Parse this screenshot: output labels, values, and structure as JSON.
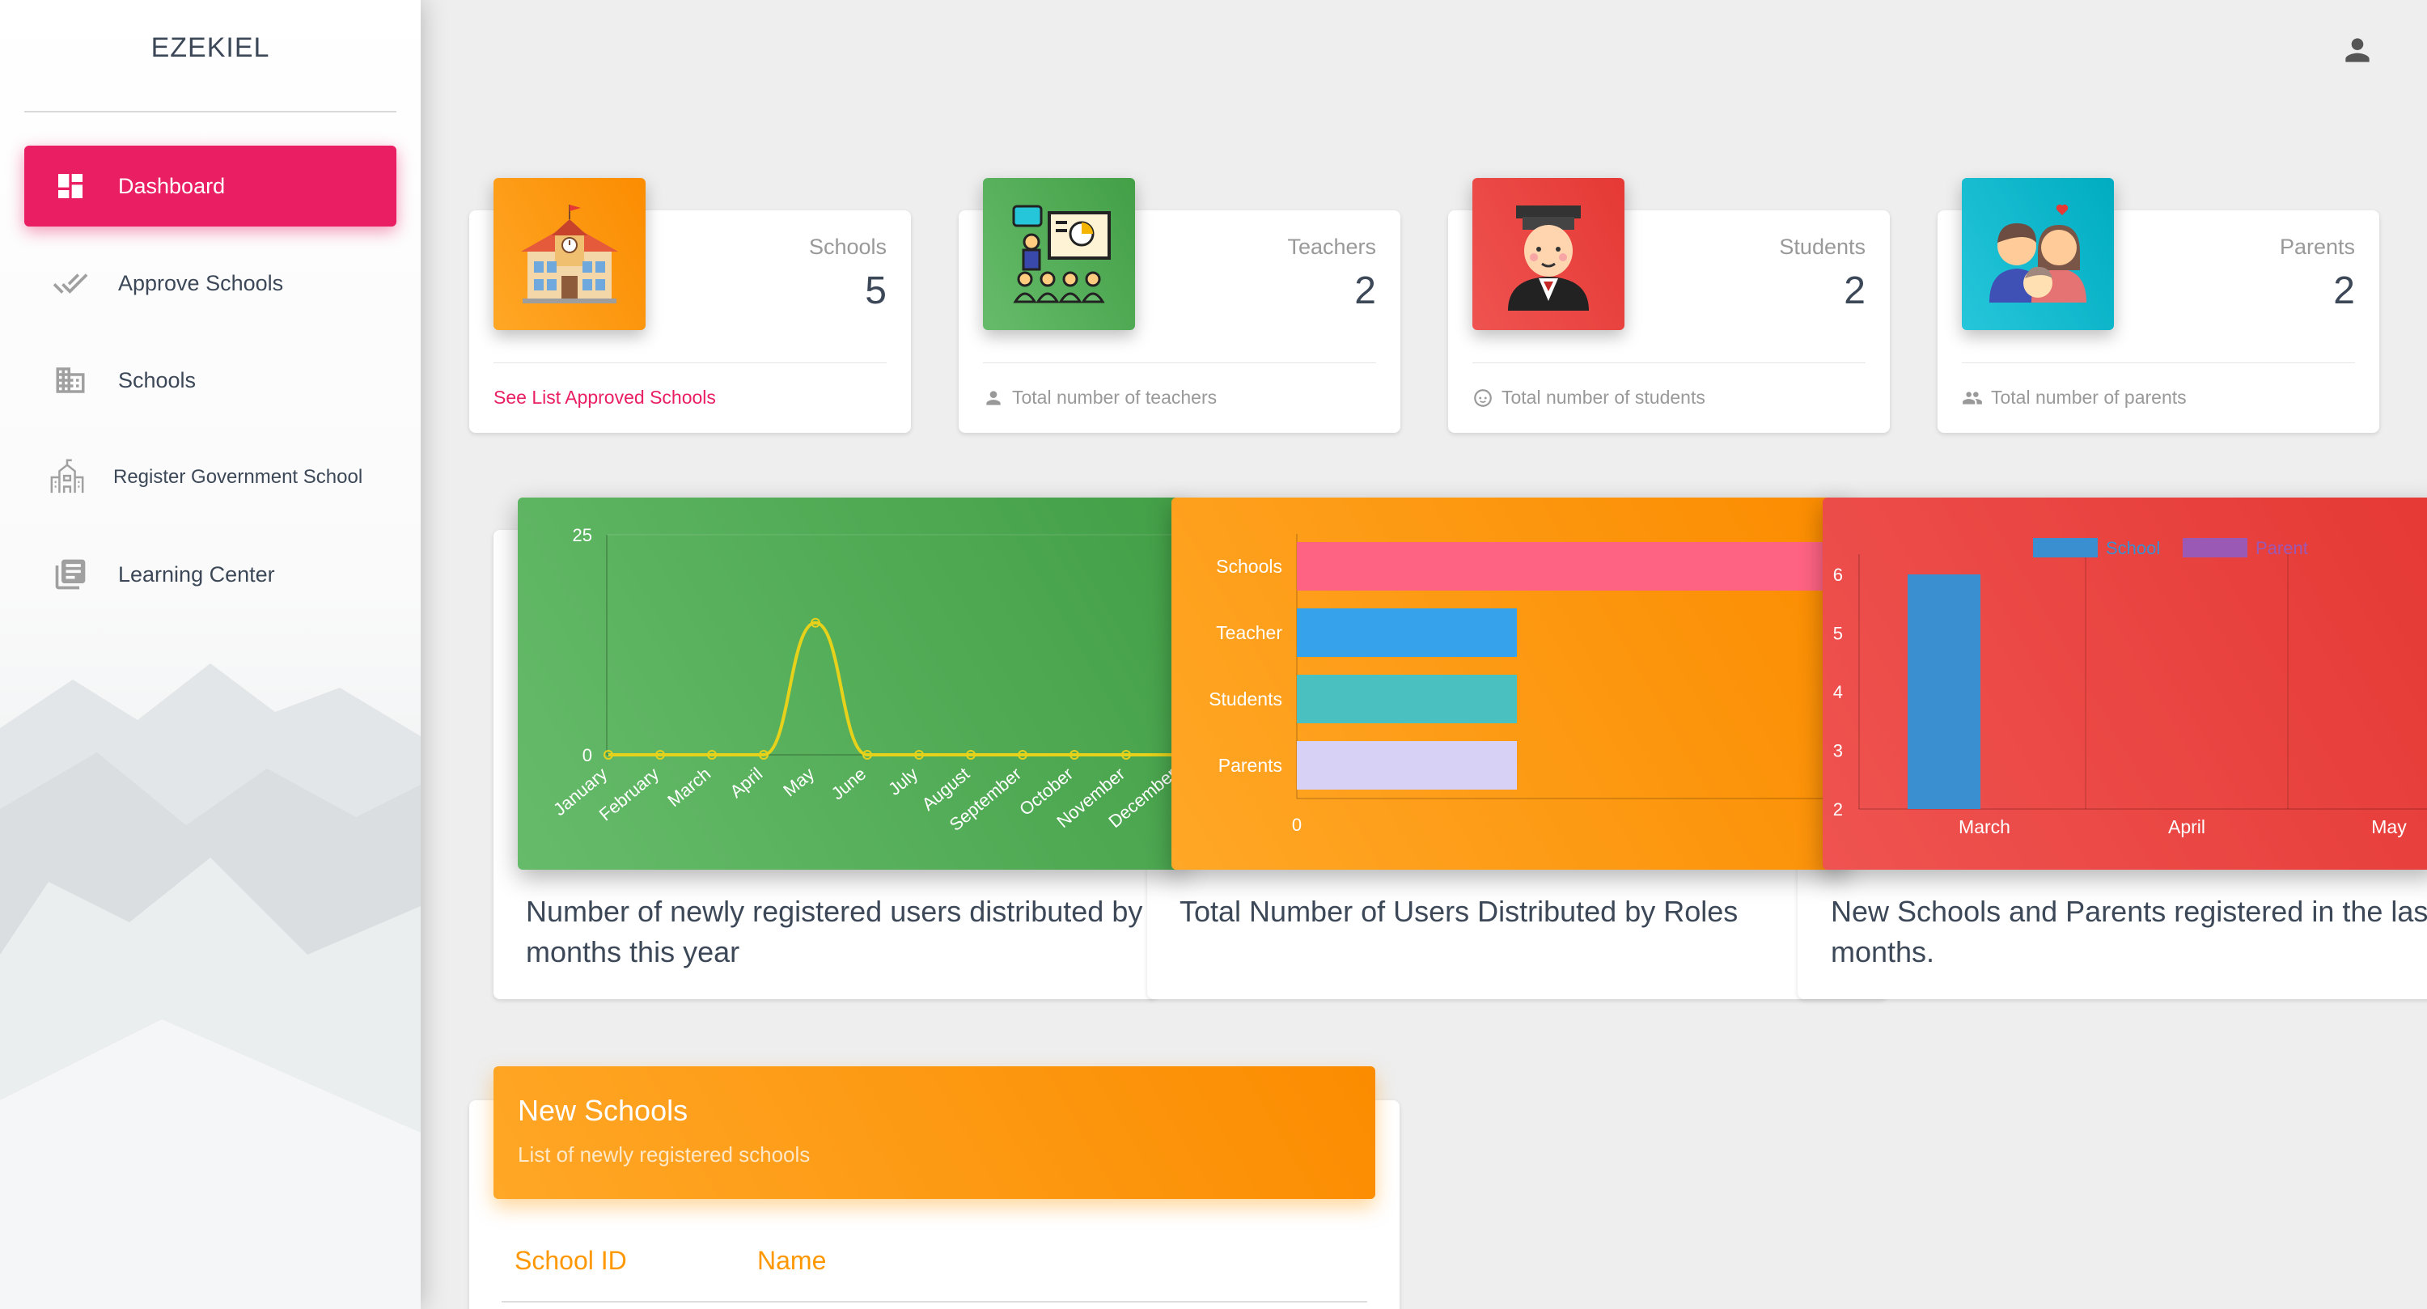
{
  "sidebar": {
    "brand": "EZEKIEL",
    "items": [
      {
        "label": "Dashboard",
        "icon": "dashboard-icon",
        "active": true
      },
      {
        "label": "Approve Schools",
        "icon": "double-check-icon"
      },
      {
        "label": "Schools",
        "icon": "building-icon"
      },
      {
        "label": "Register Government School",
        "icon": "school-register-icon"
      },
      {
        "label": "Learning Center",
        "icon": "library-books-icon"
      }
    ]
  },
  "header": {
    "user_icon": "person-icon"
  },
  "stats": [
    {
      "label": "Schools",
      "value": "5",
      "footer": "See List Approved Schools",
      "color": "#ff9800"
    },
    {
      "label": "Teachers",
      "value": "2",
      "footer": "Total number of teachers",
      "color": "#4caf50"
    },
    {
      "label": "Students",
      "value": "2",
      "footer": "Total number of students",
      "color": "#f44336"
    },
    {
      "label": "Parents",
      "value": "2",
      "footer": "Total number of parents",
      "color": "#00bcd4"
    }
  ],
  "charts": {
    "captions": [
      "Number of newly registered users distributed by months this year",
      "Total Number of Users Distributed by Roles",
      "New Schools and Parents registered in the last months."
    ]
  },
  "chart_data": [
    {
      "type": "line",
      "x": [
        "January",
        "February",
        "March",
        "April",
        "May",
        "June",
        "July",
        "August",
        "September",
        "October",
        "November",
        "December"
      ],
      "series": [
        {
          "values": [
            0,
            0,
            0,
            0,
            15,
            0,
            0,
            0,
            0,
            0,
            0,
            0
          ]
        }
      ],
      "ylim": [
        0,
        25
      ],
      "yticks": [
        "25",
        "0"
      ],
      "background": "#4caf50"
    },
    {
      "type": "bar",
      "orientation": "horizontal",
      "categories": [
        "Schools",
        "Teacher",
        "Students",
        "Parents"
      ],
      "values": [
        5,
        2,
        2,
        2
      ],
      "colors": [
        "#ff6384",
        "#36a2eb",
        "#4bc0c0",
        "#d7d2f5"
      ],
      "xticks": [
        "0"
      ],
      "background": "#ff9800"
    },
    {
      "type": "bar",
      "categories": [
        "March",
        "April",
        "May"
      ],
      "series": [
        {
          "name": "School",
          "values": [
            6,
            0,
            0
          ],
          "color": "#3a8fd0"
        },
        {
          "name": "Parent",
          "values": [
            0,
            0,
            0
          ],
          "color": "#9b59b6"
        }
      ],
      "ylim": [
        2,
        6
      ],
      "yticks": [
        "6",
        "5",
        "4",
        "3",
        "2"
      ],
      "legend": "top",
      "background": "#f44336"
    }
  ],
  "new_schools": {
    "title": "New Schools",
    "subtitle": "List of newly registered schools",
    "columns": [
      "School ID",
      "Name"
    ]
  }
}
